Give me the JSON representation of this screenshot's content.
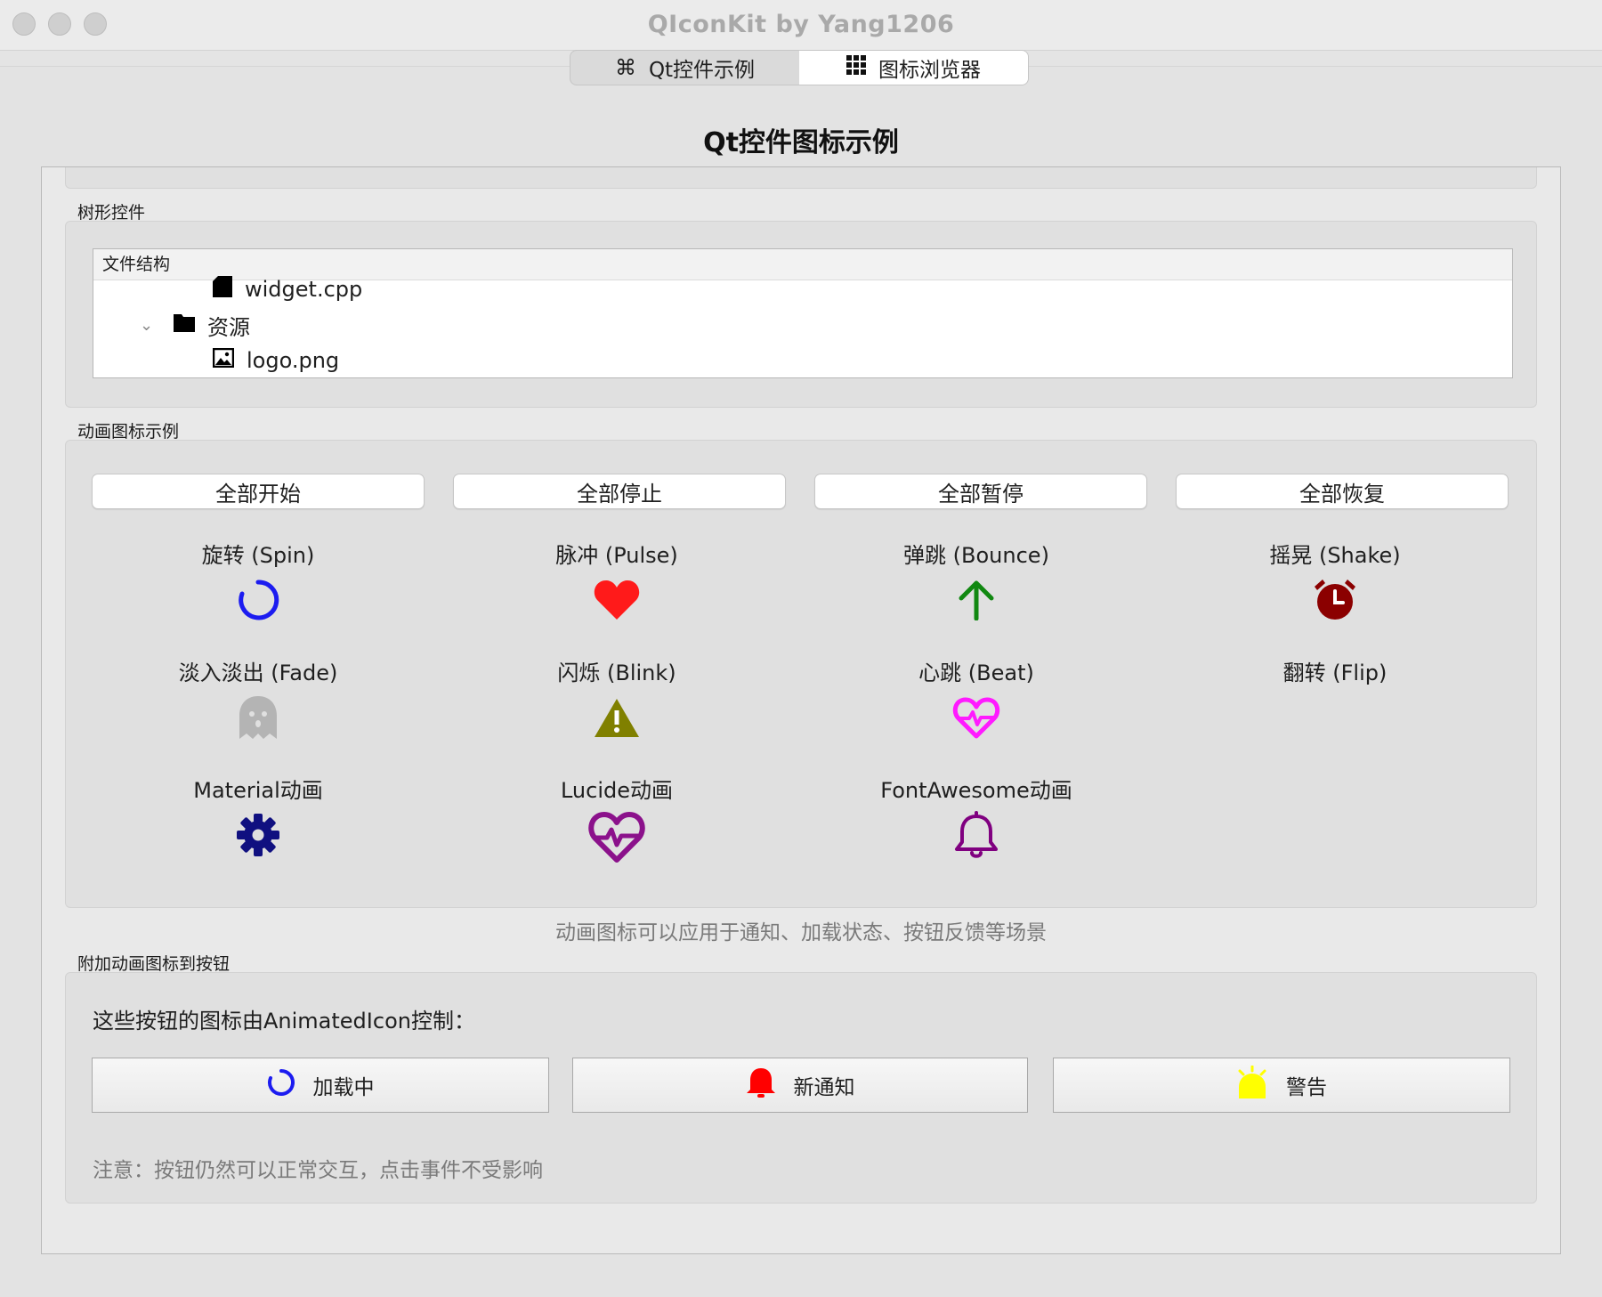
{
  "window": {
    "title": "QIconKit by Yang1206"
  },
  "tabs": [
    {
      "label": "Qt控件示例",
      "icon": "command-icon"
    },
    {
      "label": "图标浏览器",
      "icon": "grid-icon"
    }
  ],
  "page_title": "Qt控件图标示例",
  "tree_section": {
    "label": "树形控件",
    "header": "文件结构",
    "rows": [
      {
        "name": "widget.cpp",
        "icon": "file-icon"
      },
      {
        "name": "资源",
        "icon": "folder-icon",
        "expanded": true
      },
      {
        "name": "logo.png",
        "icon": "image-icon"
      }
    ]
  },
  "anim_section": {
    "label": "动画图标示例",
    "buttons": [
      "全部开始",
      "全部停止",
      "全部暂停",
      "全部恢复"
    ],
    "items": [
      {
        "label": "旋转 (Spin)",
        "icon": "spinner-icon",
        "color": "#1c1cf0"
      },
      {
        "label": "脉冲 (Pulse)",
        "icon": "heart-icon",
        "color": "#ff1a1a"
      },
      {
        "label": "弹跳 (Bounce)",
        "icon": "arrow-up-icon",
        "color": "#118811"
      },
      {
        "label": "摇晃 (Shake)",
        "icon": "alarm-clock-icon",
        "color": "#8b0000"
      },
      {
        "label": "淡入淡出 (Fade)",
        "icon": "ghost-icon",
        "color": "#b4b4b4"
      },
      {
        "label": "闪烁 (Blink)",
        "icon": "warning-icon",
        "color": "#808000"
      },
      {
        "label": "心跳 (Beat)",
        "icon": "heart-pulse-icon",
        "color": "#ff1aff"
      },
      {
        "label": "翻转 (Flip)",
        "icon": "",
        "color": ""
      },
      {
        "label": "Material动画",
        "icon": "gear-icon",
        "color": "#101080"
      },
      {
        "label": "Lucide动画",
        "icon": "heart-pulse-icon",
        "color": "#8b118b"
      },
      {
        "label": "FontAwesome动画",
        "icon": "bell-icon",
        "color": "#800080"
      }
    ]
  },
  "hint_text": "动画图标可以应用于通知、加载状态、按钮反馈等场景",
  "attach_section": {
    "label": "附加动画图标到按钮",
    "description": "这些按钮的图标由AnimatedIcon控制：",
    "buttons": [
      {
        "label": "加载中",
        "icon": "spinner-icon",
        "color": "#1c1cf0"
      },
      {
        "label": "新通知",
        "icon": "bell-icon",
        "color": "#ff0000"
      },
      {
        "label": "警告",
        "icon": "alert-light-icon",
        "color": "#ffff00"
      }
    ],
    "note": "注意：按钮仍然可以正常交互，点击事件不受影响"
  }
}
